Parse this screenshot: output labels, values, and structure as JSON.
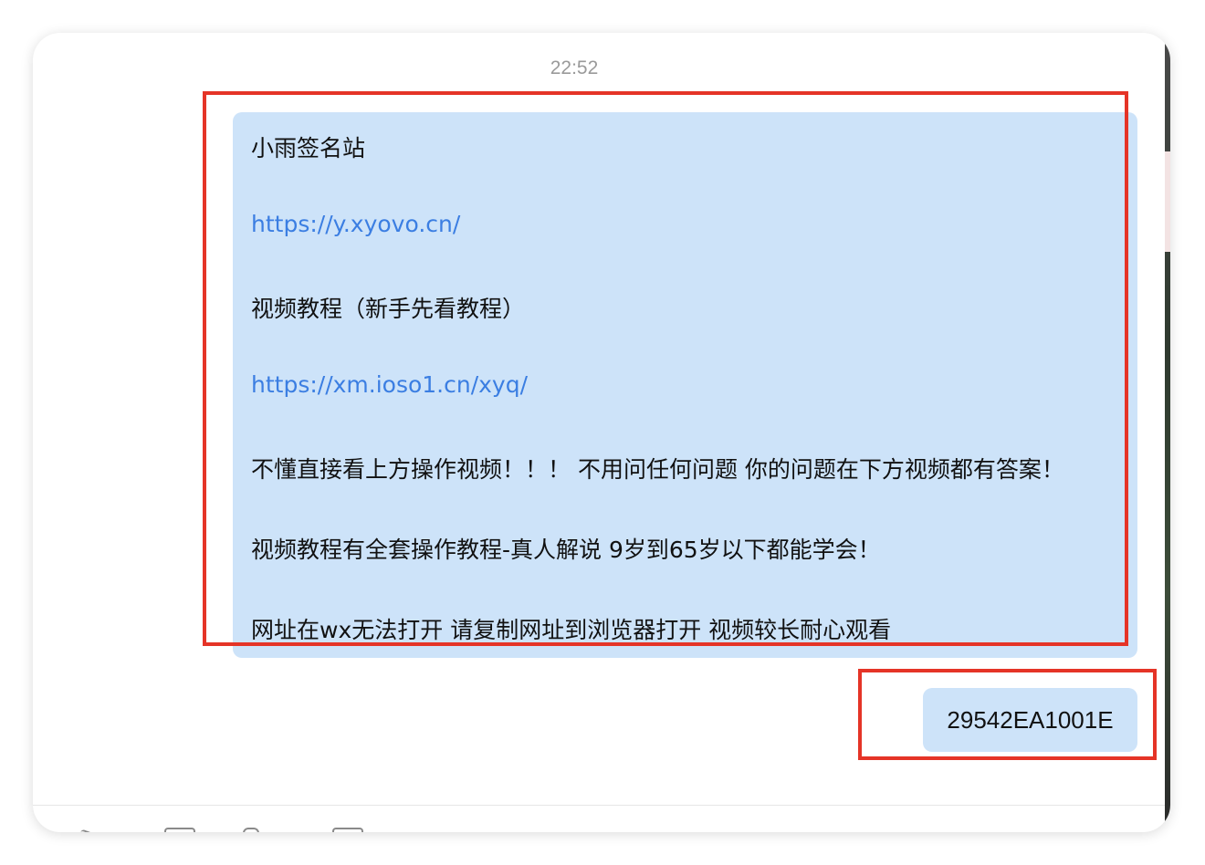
{
  "chat": {
    "timestamp": "22:52",
    "message1": {
      "line1": "小雨签名站",
      "line2": "https://y.xyovo.cn/",
      "line3": "视频教程（新手先看教程）",
      "line4": "https://xm.ioso1.cn/xyq/",
      "line5": "不懂直接看上方操作视频！！！  不用问任何问题 你的问题在下方视频都有答案！",
      "line6": "视频教程有全套操作教程-真人解说 9岁到65岁以下都能学会！",
      "line7": "网址在wx无法打开 请复制网址到浏览器打开 视频较长耐心观看"
    },
    "message2": "29542EA1001E"
  },
  "toolbar": {
    "icons": [
      "scissors-icon",
      "folder-icon",
      "attachment-icon",
      "screenshot-icon"
    ]
  },
  "colors": {
    "bubble": "#cde3f9",
    "link": "#3b7ee2",
    "highlight": "#e53427"
  }
}
